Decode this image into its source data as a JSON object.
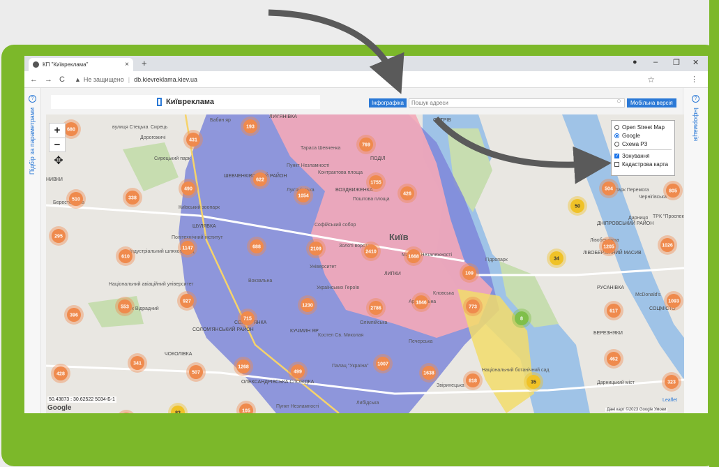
{
  "colors": {
    "frame": "#7cb82a",
    "arrow": "#5a5a5a",
    "accent": "#2b79d6",
    "cluster_orange": "#ef8a4d",
    "cluster_yellow": "#f0c227",
    "cluster_green": "#7fbf4a",
    "zone_blue": "#7e87d9",
    "zone_pink": "#f4a8b8",
    "river": "#9fc3e7",
    "park": "#c7ddb0"
  },
  "browser": {
    "tab_title": "КП \"Київреклама\"",
    "tab_close": "×",
    "new_tab": "+",
    "win_min": "–",
    "win_max": "❐",
    "win_close": "✕",
    "back": "←",
    "forward": "→",
    "reload": "C",
    "security_icon": "▲",
    "not_secure": "Не защищено",
    "separator": "|",
    "url": "db.kievreklama.kiev.ua",
    "bookmark": "☆",
    "menu": "⋮"
  },
  "app": {
    "logo": "Київреклама",
    "left_panel": "Підбір за параметрами",
    "right_panel": "Інформація",
    "panel_icon": "?",
    "info_tab": "Інфографіка",
    "search_placeholder": "Пошук адреси",
    "search_icon": "○",
    "mobile_button": "Мобільна версія"
  },
  "map": {
    "zoom_in": "+",
    "zoom_out": "−",
    "pan": "✥",
    "coords": "50.43873 : 30.62522 5034-Б-1",
    "google_mark": "Google",
    "attribution": "Дані карт ©2023 Google   Умови",
    "leaflet": "Leaflet",
    "layers": {
      "base": [
        {
          "label": "Open Street Map",
          "checked": false
        },
        {
          "label": "Google",
          "checked": true
        },
        {
          "label": "Схема РЗ",
          "checked": false
        }
      ],
      "overlays": [
        {
          "label": "Зонування",
          "checked": true
        },
        {
          "label": "Кадастрова карта",
          "checked": false
        }
      ]
    },
    "labels": [
      {
        "text": "вулиця Стецька",
        "cls": ""
      },
      {
        "text": "Сирець",
        "cls": ""
      },
      {
        "text": "Дорогожичі",
        "cls": ""
      },
      {
        "text": "Бабин яр",
        "cls": ""
      },
      {
        "text": "ЛУК'ЯНІВКА",
        "cls": "district"
      },
      {
        "text": "Тараса Шевченка",
        "cls": ""
      },
      {
        "text": "Пункт Незламності",
        "cls": ""
      },
      {
        "text": "ПОДІЛ",
        "cls": "district"
      },
      {
        "text": "Контрактова площа",
        "cls": ""
      },
      {
        "text": "Сирецький парк",
        "cls": ""
      },
      {
        "text": "НИВКИ",
        "cls": "district"
      },
      {
        "text": "Берестейська",
        "cls": ""
      },
      {
        "text": "ШЕВЧЕНКІВСЬКИЙ РАЙОН",
        "cls": "district"
      },
      {
        "text": "Лук'янівська",
        "cls": ""
      },
      {
        "text": "ВОЗДВИЖЕНКА",
        "cls": "district"
      },
      {
        "text": "Поштова площа",
        "cls": ""
      },
      {
        "text": "Київський зоопарк",
        "cls": ""
      },
      {
        "text": "ШУЛЯВКА",
        "cls": "district"
      },
      {
        "text": "Політехнічний інститут",
        "cls": ""
      },
      {
        "text": "Софійський собор",
        "cls": ""
      },
      {
        "text": "Золоті ворота",
        "cls": ""
      },
      {
        "text": "Київ",
        "cls": "big"
      },
      {
        "text": "Майдан Незалежності",
        "cls": ""
      },
      {
        "text": "Індустріальний шляхопровід",
        "cls": ""
      },
      {
        "text": "Вокзальна",
        "cls": ""
      },
      {
        "text": "Університет",
        "cls": ""
      },
      {
        "text": "Українських Героїв",
        "cls": ""
      },
      {
        "text": "ЛИПКИ",
        "cls": "district"
      },
      {
        "text": "Арсенальна",
        "cls": ""
      },
      {
        "text": "Національний авіаційний університет",
        "cls": ""
      },
      {
        "text": "Парк Відрадний",
        "cls": ""
      },
      {
        "text": "СОЛОМ'ЯНКА",
        "cls": "district"
      },
      {
        "text": "СОЛОМ'ЯНСЬКИЙ РАЙОН",
        "cls": "district"
      },
      {
        "text": "КУЧМИН ЯР",
        "cls": "district"
      },
      {
        "text": "Олімпійська",
        "cls": ""
      },
      {
        "text": "Печерська",
        "cls": ""
      },
      {
        "text": "Костел Св. Миколая",
        "cls": ""
      },
      {
        "text": "ЧОКОЛІВКА",
        "cls": "district"
      },
      {
        "text": "Палац \"Україна\"",
        "cls": ""
      },
      {
        "text": "Звіринецька",
        "cls": ""
      },
      {
        "text": "ОЛЕКСАНДРІВСЬКА СЛОБІДКА",
        "cls": "district"
      },
      {
        "text": "Либідська",
        "cls": ""
      },
      {
        "text": "Пункт Незламності",
        "cls": ""
      },
      {
        "text": "ОСТРІВ",
        "cls": "district"
      },
      {
        "text": "Гідропарк",
        "cls": ""
      },
      {
        "text": "Лівобережна",
        "cls": ""
      },
      {
        "text": "ЛІВОБЕРЕЖНИЙ МАСИВ",
        "cls": "district"
      },
      {
        "text": "ДНІПРОВСЬКИЙ РАЙОН",
        "cls": "district"
      },
      {
        "text": "Парк Перемога",
        "cls": ""
      },
      {
        "text": "Чернігівська",
        "cls": ""
      },
      {
        "text": "Дарниця",
        "cls": ""
      },
      {
        "text": "ТРК \"Проспект\"",
        "cls": ""
      },
      {
        "text": "РУСАНІВКА",
        "cls": "district"
      },
      {
        "text": "McDonald's",
        "cls": ""
      },
      {
        "text": "СОЦМІСТО",
        "cls": "district"
      },
      {
        "text": "БЕРЕЗНЯКИ",
        "cls": "district"
      },
      {
        "text": "Дарницький міст",
        "cls": ""
      },
      {
        "text": "Національний ботанічний сад",
        "cls": ""
      },
      {
        "text": "Кловська",
        "cls": ""
      }
    ],
    "clusters": [
      {
        "n": "680",
        "c": "o"
      },
      {
        "n": "431",
        "c": "o"
      },
      {
        "n": "193",
        "c": "o"
      },
      {
        "n": "769",
        "c": "o"
      },
      {
        "n": "622",
        "c": "o"
      },
      {
        "n": "1755",
        "c": "o"
      },
      {
        "n": "490",
        "c": "o"
      },
      {
        "n": "1054",
        "c": "o"
      },
      {
        "n": "426",
        "c": "o"
      },
      {
        "n": "510",
        "c": "o"
      },
      {
        "n": "338",
        "c": "o"
      },
      {
        "n": "295",
        "c": "o"
      },
      {
        "n": "1147",
        "c": "o"
      },
      {
        "n": "688",
        "c": "o"
      },
      {
        "n": "2109",
        "c": "o"
      },
      {
        "n": "2410",
        "c": "o"
      },
      {
        "n": "1668",
        "c": "o"
      },
      {
        "n": "610",
        "c": "o"
      },
      {
        "n": "109",
        "c": "o"
      },
      {
        "n": "927",
        "c": "o"
      },
      {
        "n": "553",
        "c": "o"
      },
      {
        "n": "1230",
        "c": "o"
      },
      {
        "n": "2786",
        "c": "o"
      },
      {
        "n": "1846",
        "c": "o"
      },
      {
        "n": "773",
        "c": "o"
      },
      {
        "n": "396",
        "c": "o"
      },
      {
        "n": "715",
        "c": "o"
      },
      {
        "n": "341",
        "c": "o"
      },
      {
        "n": "507",
        "c": "o"
      },
      {
        "n": "1268",
        "c": "o"
      },
      {
        "n": "499",
        "c": "o"
      },
      {
        "n": "1007",
        "c": "o"
      },
      {
        "n": "1638",
        "c": "o"
      },
      {
        "n": "818",
        "c": "o"
      },
      {
        "n": "428",
        "c": "o"
      },
      {
        "n": "105",
        "c": "o"
      },
      {
        "n": "205",
        "c": "o"
      },
      {
        "n": "83",
        "c": "y"
      },
      {
        "n": "35",
        "c": "y"
      },
      {
        "n": "8",
        "c": "g"
      },
      {
        "n": "34",
        "c": "y"
      },
      {
        "n": "50",
        "c": "y"
      },
      {
        "n": "504",
        "c": "o"
      },
      {
        "n": "805",
        "c": "o"
      },
      {
        "n": "1205",
        "c": "o"
      },
      {
        "n": "1026",
        "c": "o"
      },
      {
        "n": "1093",
        "c": "o"
      },
      {
        "n": "617",
        "c": "o"
      },
      {
        "n": "462",
        "c": "o"
      },
      {
        "n": "323",
        "c": "o"
      }
    ]
  }
}
